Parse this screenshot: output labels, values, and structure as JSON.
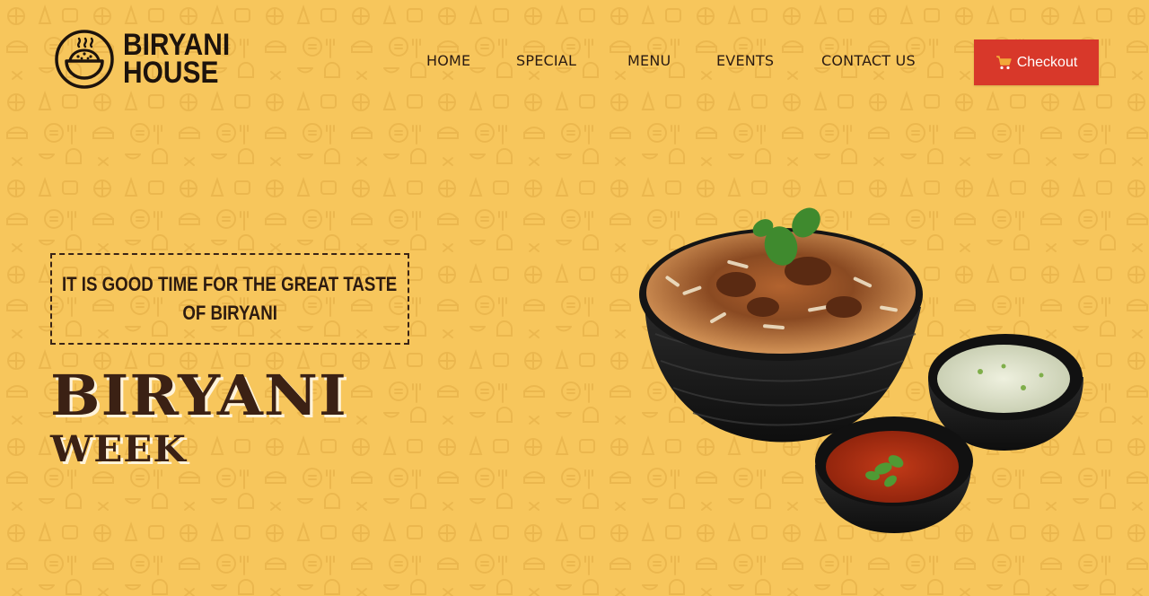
{
  "brand": {
    "line1": "BIRYANI",
    "line2": "HOUSE",
    "logo_icon": "biryani-bowl-icon"
  },
  "nav": {
    "items": [
      {
        "label": "HOME"
      },
      {
        "label": "SPECIAL"
      },
      {
        "label": "MENU"
      },
      {
        "label": "EVENTS"
      },
      {
        "label": "CONTACT US"
      }
    ]
  },
  "checkout": {
    "label": "Checkout",
    "icon": "cart-icon"
  },
  "hero": {
    "tagline_line1": "IT IS GOOD TIME FOR THE GREAT TASTE",
    "tagline_line2": "OF BIRYANI",
    "title_line1": "BIRYANI",
    "title_line2": "WEEK"
  },
  "colors": {
    "background": "#f7c65c",
    "accent": "#d8382a",
    "text_dark": "#2b1b12"
  }
}
